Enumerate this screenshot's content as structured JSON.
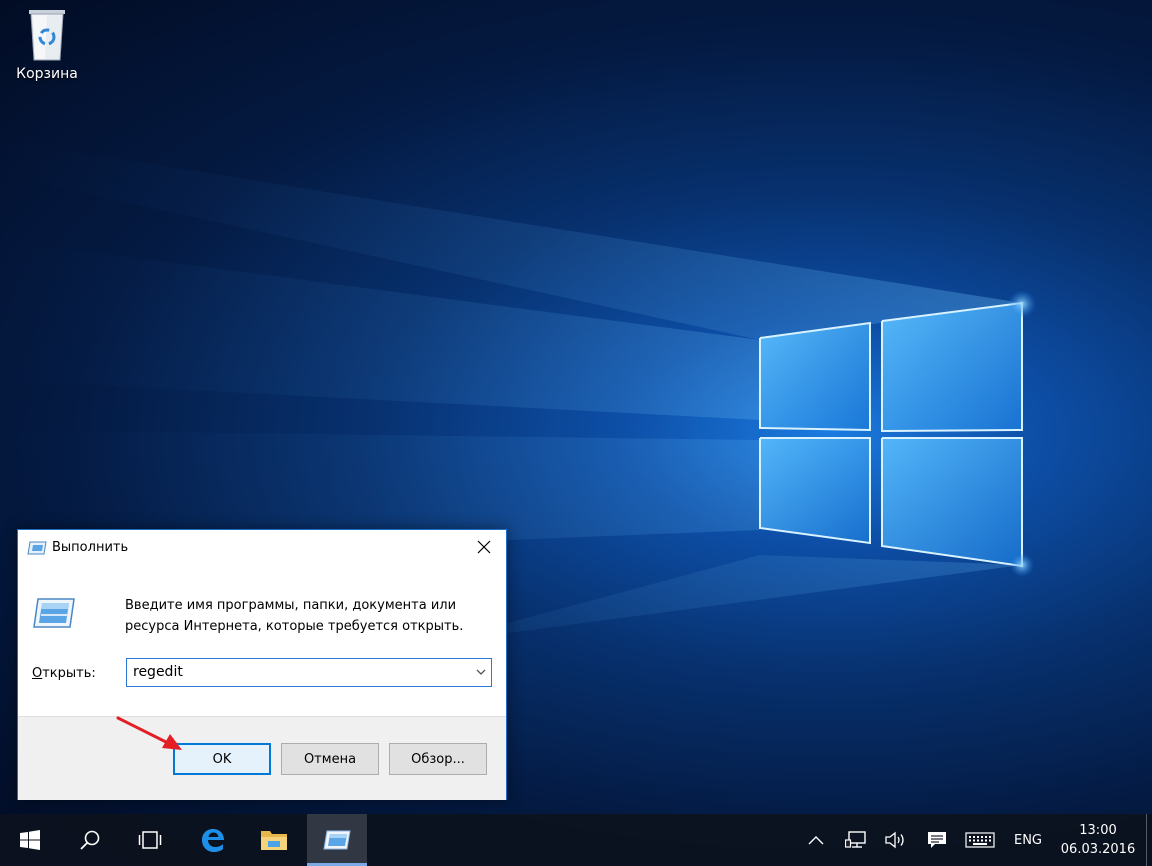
{
  "desktop": {
    "recycle_bin_label": "Корзина"
  },
  "run_dialog": {
    "title": "Выполнить",
    "description_line1": "Введите имя программы, папки, документа или",
    "description_line2": "ресурса Интернета, которые требуется открыть.",
    "open_label_accel": "О",
    "open_label_rest": "ткрыть:",
    "open_value": "regedit",
    "ok_label": "OK",
    "cancel_label": "Отмена",
    "browse_label": "Обзор..."
  },
  "taskbar": {
    "pinned": [
      "windows-start-icon",
      "search-icon",
      "task-view-icon",
      "edge-icon",
      "file-explorer-icon",
      "run-icon"
    ],
    "tray": {
      "language": "ENG",
      "time": "13:00",
      "date": "06.03.2016"
    }
  },
  "colors": {
    "accent": "#0078d7",
    "annotation_arrow": "#e31e24"
  }
}
